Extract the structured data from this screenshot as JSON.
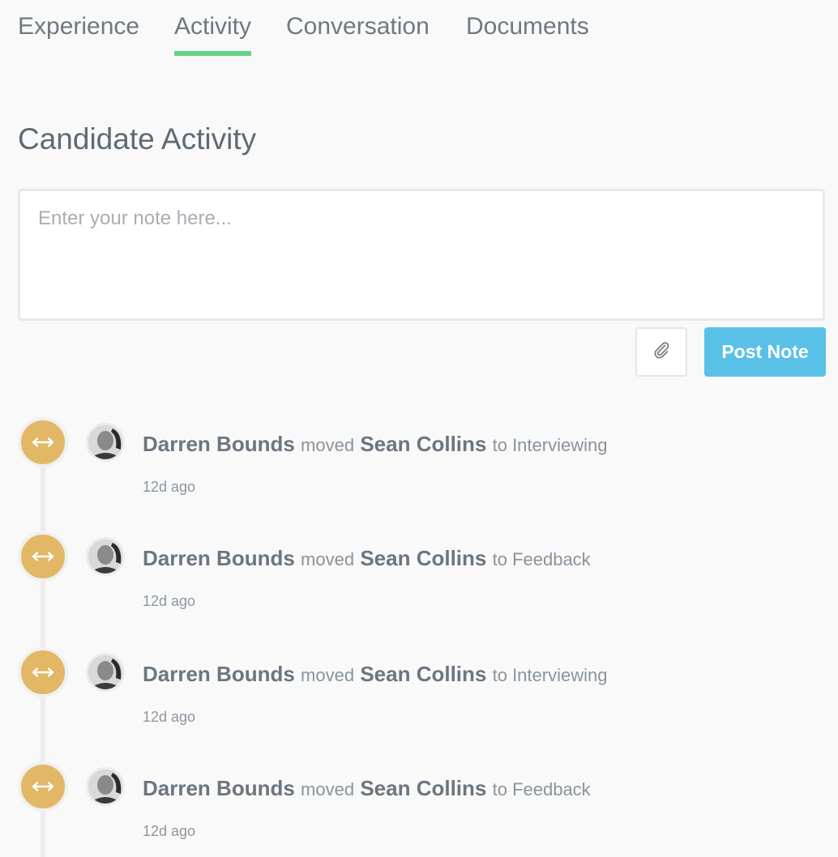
{
  "tabs": [
    {
      "label": "Experience"
    },
    {
      "label": "Activity"
    },
    {
      "label": "Conversation"
    },
    {
      "label": "Documents"
    }
  ],
  "active_tab": "Activity",
  "title": "Candidate Activity",
  "note": {
    "placeholder": "Enter your note here...",
    "value": ""
  },
  "buttons": {
    "attach_icon": "paperclip-icon",
    "post_label": "Post Note"
  },
  "colors": {
    "active_tab_underline": "#66d384",
    "post_button": "#59c1e8",
    "event_icon": "#e2b766"
  },
  "events": [
    {
      "actor": "Darren Bounds",
      "verb": "moved",
      "subject": "Sean Collins",
      "dest": "to Interviewing",
      "time": "12d ago",
      "icon": "arrows-horizontal-icon"
    },
    {
      "actor": "Darren Bounds",
      "verb": "moved",
      "subject": "Sean Collins",
      "dest": "to Feedback",
      "time": "12d ago",
      "icon": "arrows-horizontal-icon"
    },
    {
      "actor": "Darren Bounds",
      "verb": "moved",
      "subject": "Sean Collins",
      "dest": "to Interviewing",
      "time": "12d ago",
      "icon": "arrows-horizontal-icon"
    },
    {
      "actor": "Darren Bounds",
      "verb": "moved",
      "subject": "Sean Collins",
      "dest": "to Feedback",
      "time": "12d ago",
      "icon": "arrows-horizontal-icon"
    }
  ]
}
